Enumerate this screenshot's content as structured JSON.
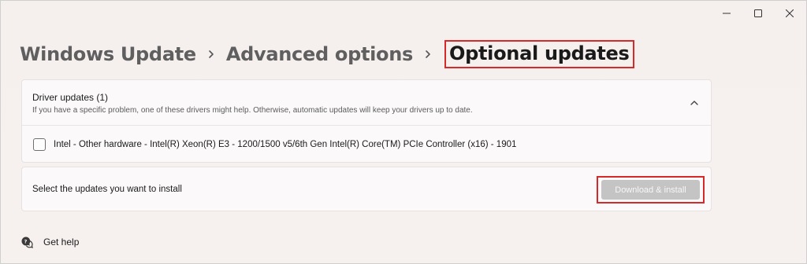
{
  "window_controls": {
    "minimize_icon": "minimize-icon",
    "maximize_icon": "maximize-icon",
    "close_icon": "close-icon"
  },
  "breadcrumb": {
    "items": [
      "Windows Update",
      "Advanced options"
    ],
    "current": "Optional updates",
    "separator_icon": "chevron-right-icon"
  },
  "driver_updates": {
    "title": "Driver updates (1)",
    "description": "If you have a specific problem, one of these drivers might help. Otherwise, automatic updates will keep your drivers up to date.",
    "expanded": true,
    "items": [
      {
        "name": "Intel - Other hardware - Intel(R) Xeon(R) E3 - 1200/1500 v5/6th Gen Intel(R) Core(TM) PCIe Controller (x16) - 1901",
        "checked": false
      }
    ]
  },
  "install": {
    "prompt": "Select the updates you want to install",
    "button_label": "Download & install",
    "button_enabled": false
  },
  "help": {
    "label": "Get help",
    "icon": "get-help-icon"
  },
  "colors": {
    "highlight_border": "#d62a2a",
    "background": "#f5efee",
    "card": "#fbf9f9",
    "disabled_button": "#c4c4c4"
  }
}
